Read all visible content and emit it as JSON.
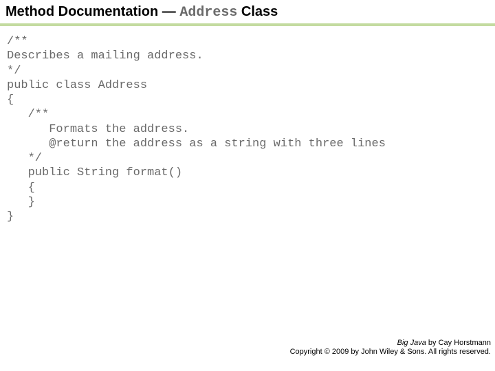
{
  "title": {
    "prefix": "Method Documentation — ",
    "classname": "Address",
    "suffix": " Class"
  },
  "code": "/**\nDescribes a mailing address.\n*/\npublic class Address\n{\n   /**\n      Formats the address.\n      @return the address as a string with three lines\n   */\n   public String format()\n   {\n   }\n}",
  "footer": {
    "bookname": "Big Java",
    "byline": " by Cay Horstmann",
    "copyright": "Copyright © 2009 by John Wiley & Sons.  All rights reserved."
  }
}
